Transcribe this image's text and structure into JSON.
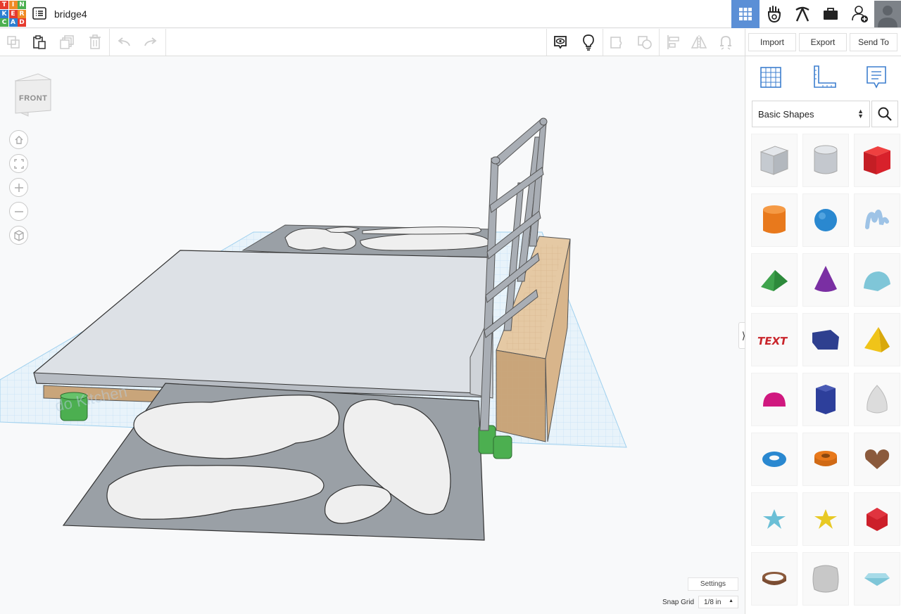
{
  "app": {
    "logo_letters": [
      "T",
      "I",
      "N",
      "K",
      "E",
      "R",
      "C",
      "A",
      "D"
    ],
    "logo_colors": [
      "#e63b2e",
      "#f08a24",
      "#4caf50",
      "#2e7fd1",
      "#e63b2e",
      "#f08a24",
      "#4caf50",
      "#2e7fd1",
      "#e63b2e"
    ],
    "doc_title": "bridge4",
    "accent": "#5b8fd6"
  },
  "top_icons": [
    "grid-view-icon",
    "gallery-icon",
    "pickaxe-icon",
    "briefcase-icon",
    "add-user-icon",
    "avatar"
  ],
  "toolbar": {
    "left_icons": [
      "copy-icon",
      "paste-icon",
      "duplicate-icon",
      "delete-icon",
      "undo-icon",
      "redo-icon"
    ],
    "view_icons": [
      "show-all-icon",
      "lightbulb-icon",
      "group-icon",
      "ungroup-icon",
      "align-icon",
      "mirror-icon",
      "magnet-icon"
    ]
  },
  "right_toolbar": {
    "import_label": "Import",
    "export_label": "Export",
    "send_to_label": "Send To"
  },
  "panel": {
    "tabs": [
      "workplane-icon",
      "ruler-icon",
      "notes-icon"
    ],
    "category": "Basic Shapes",
    "shapes": [
      {
        "name": "box-hole",
        "color": "#b8bec6"
      },
      {
        "name": "cylinder-hole",
        "color": "#c4c8ce"
      },
      {
        "name": "box",
        "color": "#d8212b"
      },
      {
        "name": "cylinder",
        "color": "#e8791c"
      },
      {
        "name": "sphere",
        "color": "#2a88d0"
      },
      {
        "name": "scribble",
        "color": "#9ec3e6"
      },
      {
        "name": "roof",
        "color": "#3fa34d"
      },
      {
        "name": "cone",
        "color": "#7a2fa3"
      },
      {
        "name": "round-roof",
        "color": "#7fc6d8"
      },
      {
        "name": "text",
        "color": "#c9252b"
      },
      {
        "name": "polygon",
        "color": "#2e3f8f"
      },
      {
        "name": "pyramid",
        "color": "#f0c419"
      },
      {
        "name": "half-sphere",
        "color": "#d0187f"
      },
      {
        "name": "hexagonal-prism",
        "color": "#2d3f9b"
      },
      {
        "name": "paraboloid",
        "color": "#dcdcdc"
      },
      {
        "name": "torus",
        "color": "#2a88d0"
      },
      {
        "name": "tube",
        "color": "#e8791c"
      },
      {
        "name": "heart",
        "color": "#8b5a3c"
      },
      {
        "name": "star",
        "color": "#6bbfd6"
      },
      {
        "name": "star-gold",
        "color": "#e8c924"
      },
      {
        "name": "icosahedron",
        "color": "#cc1f2a"
      },
      {
        "name": "ring",
        "color": "#8b5a3c"
      },
      {
        "name": "rounded-box",
        "color": "#c8c8c8"
      },
      {
        "name": "diamond",
        "color": "#7fc6d8"
      }
    ]
  },
  "viewcube_label": "FRONT",
  "nav_buttons": [
    "home-icon",
    "fit-all-icon",
    "zoom-in-icon",
    "zoom-out-icon",
    "perspective-icon"
  ],
  "bottom": {
    "settings_label": "Settings",
    "snap_label": "Snap Grid",
    "snap_value": "1/8 in"
  }
}
